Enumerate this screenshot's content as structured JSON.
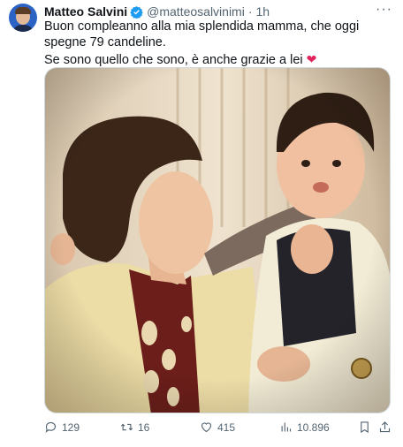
{
  "tweet": {
    "author_name": "Matteo Salvini",
    "handle": "@matteosalvinimi",
    "separator": "·",
    "time": "1h",
    "text_line1": "Buon compleanno alla mia splendida mamma, che oggi spegne 79 candeline.",
    "text_line2": "Se sono quello che sono, è anche grazie a lei"
  },
  "actions": {
    "replies": "129",
    "retweets": "16",
    "likes": "415",
    "views": "10.896"
  },
  "icons": {
    "verified": "verified-badge-icon",
    "more": "more-icon",
    "heart_emoji": "red-heart-icon",
    "reply": "reply-icon",
    "retweet": "retweet-icon",
    "like": "like-icon",
    "views": "views-icon",
    "bookmark": "bookmark-icon",
    "share": "share-icon"
  },
  "colors": {
    "verified": "#1d9bf0",
    "heart": "#e0245e",
    "muted": "#536471"
  }
}
